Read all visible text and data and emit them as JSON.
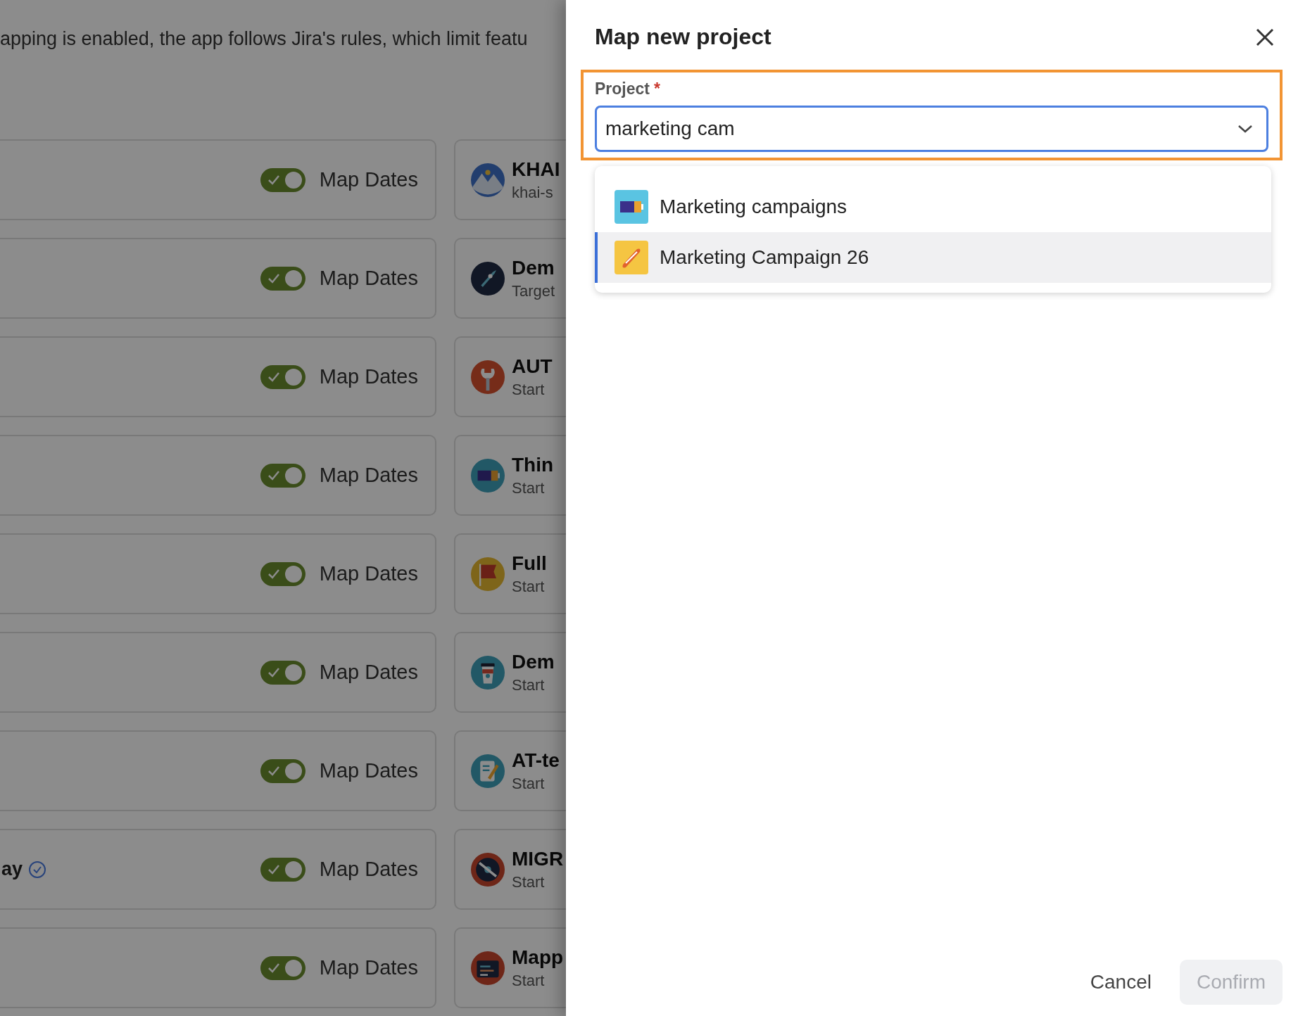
{
  "background": {
    "notice": "apping is enabled, the app follows Jira's rules, which limit featu",
    "rows": [
      {
        "toggle": {
          "on": true,
          "label": "Map Dates"
        },
        "project": {
          "name": "KHAI",
          "subtitle": "khai-s"
        }
      },
      {
        "toggle": {
          "on": true,
          "label": "Map Dates"
        },
        "project": {
          "name": "Dem",
          "subtitle": "Target"
        }
      },
      {
        "toggle": {
          "on": true,
          "label": "Map Dates"
        },
        "project": {
          "name": "AUT",
          "subtitle": "Start"
        }
      },
      {
        "toggle": {
          "on": true,
          "label": "Map Dates"
        },
        "project": {
          "name": "Thin",
          "subtitle": "Start"
        }
      },
      {
        "toggle": {
          "on": true,
          "label": "Map Dates"
        },
        "project": {
          "name": "Full",
          "subtitle": "Start"
        }
      },
      {
        "toggle": {
          "on": true,
          "label": "Map Dates"
        },
        "project": {
          "name": "Dem",
          "subtitle": "Start"
        }
      },
      {
        "toggle": {
          "on": true,
          "label": "Map Dates"
        },
        "project": {
          "name": "AT-te",
          "subtitle": "Start"
        }
      },
      {
        "left_text": "ay",
        "verified": true,
        "toggle": {
          "on": true,
          "label": "Map Dates"
        },
        "project": {
          "name": "MIGR",
          "subtitle": "Start"
        }
      },
      {
        "toggle": {
          "on": true,
          "label": "Map Dates"
        },
        "project": {
          "name": "Mapp",
          "subtitle": "Start"
        }
      }
    ]
  },
  "dialog": {
    "title": "Map new project",
    "field": {
      "label": "Project",
      "required_mark": "*",
      "value": "marketing cam"
    },
    "options": [
      {
        "label": "Marketing campaigns",
        "selected": false
      },
      {
        "label": "Marketing Campaign 26",
        "selected": true
      }
    ],
    "buttons": [
      {
        "label": "Cancel",
        "kind": "subtle"
      },
      {
        "label": "Confirm",
        "kind": "primary",
        "disabled": true
      }
    ]
  }
}
